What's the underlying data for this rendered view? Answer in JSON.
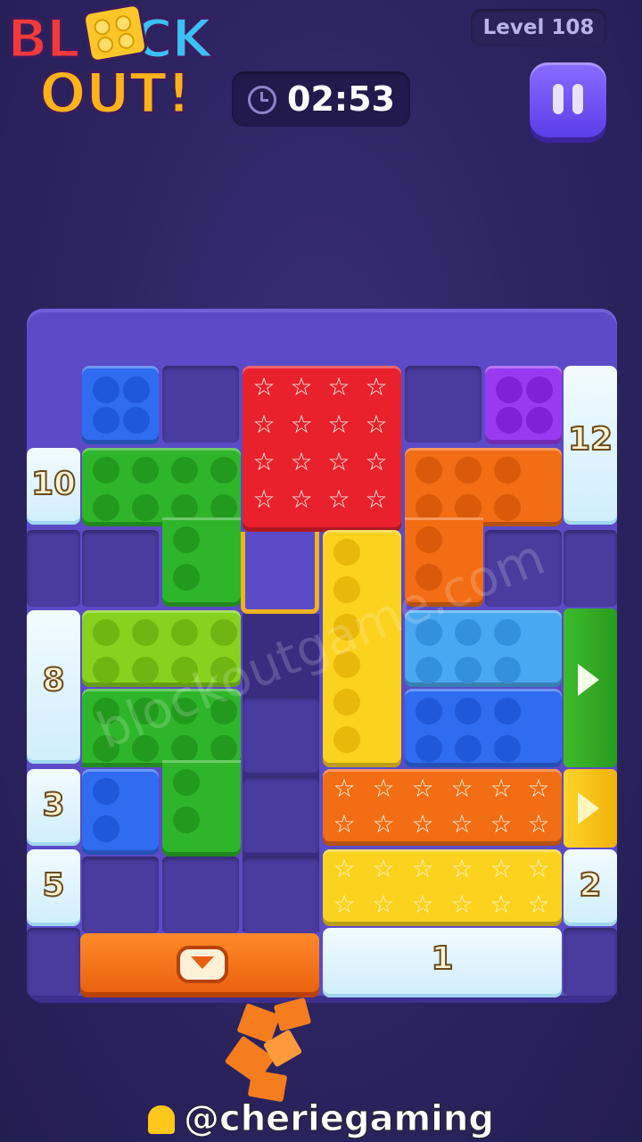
{
  "game": {
    "logo_line1": "BL",
    "logo_line1b": "CK",
    "logo_line2": "OUT!",
    "level_label": "Level 108",
    "timer": "02:53"
  },
  "gates": {
    "left_10": "10",
    "left_8": "8",
    "left_3": "3",
    "left_5": "5",
    "right_12": "12",
    "right_2": "2",
    "bottom_1": "1"
  },
  "watermark": "blockoutgame.com",
  "credit": "@cheriegaming",
  "colors": {
    "blue": "#2f6cf0",
    "green": "#2fb52a",
    "lime": "#86d21e",
    "red": "#e8212d",
    "orange": "#f26d14",
    "yellow": "#fbd21e",
    "purple": "#9a3af0",
    "sky": "#4aa8f0",
    "board": "#5b4bc6"
  }
}
